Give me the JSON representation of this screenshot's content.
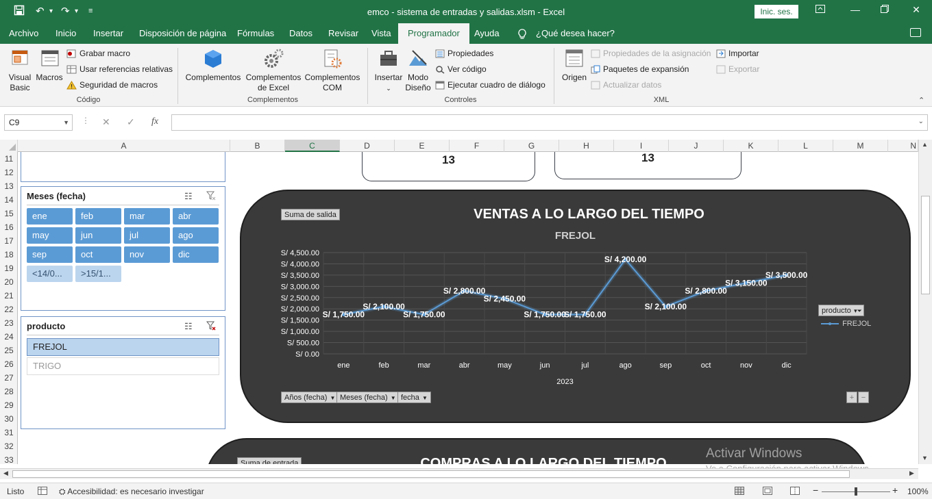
{
  "window": {
    "title": "emco - sistema de entradas y salidas.xlsm  -  Excel",
    "sign_in": "Inic. ses."
  },
  "menu": {
    "tabs": [
      "Archivo",
      "Inicio",
      "Insertar",
      "Disposición de página",
      "Fórmulas",
      "Datos",
      "Revisar",
      "Vista",
      "Programador",
      "Ayuda"
    ],
    "active_tab": "Programador",
    "tell_me": "¿Qué desea hacer?"
  },
  "ribbon": {
    "codigo": {
      "visual_basic": "Visual Basic",
      "visual_basic_l1": "Visual",
      "visual_basic_l2": "Basic",
      "macros": "Macros",
      "grabar_macro": "Grabar macro",
      "usar_referencias": "Usar referencias relativas",
      "seguridad": "Seguridad de macros",
      "group": "Código"
    },
    "complementos": {
      "complementos": "Complementos",
      "excel_l1": "Complementos",
      "excel_l2": "de Excel",
      "com_l1": "Complementos",
      "com_l2": "COM",
      "group": "Complementos"
    },
    "controles": {
      "insertar": "Insertar",
      "modo_l1": "Modo",
      "modo_l2": "Diseño",
      "propiedades": "Propiedades",
      "ver_codigo": "Ver código",
      "ejecutar": "Ejecutar cuadro de diálogo",
      "group": "Controles"
    },
    "xml": {
      "origen": "Origen",
      "propiedades_asignacion": "Propiedades de la asignación",
      "paquetes": "Paquetes de expansión",
      "actualizar": "Actualizar datos",
      "importar": "Importar",
      "exportar": "Exportar",
      "group": "XML"
    }
  },
  "formula_bar": {
    "name_box": "C9",
    "fx": "fx",
    "value": ""
  },
  "grid": {
    "columns": [
      "A",
      "B",
      "C",
      "D",
      "E",
      "F",
      "G",
      "H",
      "I",
      "J",
      "K",
      "L",
      "M",
      "N"
    ],
    "selected_column": "C",
    "rows": [
      "11",
      "12",
      "13",
      "14",
      "15",
      "16",
      "17",
      "18",
      "19",
      "20",
      "21",
      "22",
      "23",
      "24",
      "25",
      "26",
      "27",
      "28",
      "29",
      "30",
      "31",
      "32",
      "33"
    ]
  },
  "slicer_meses": {
    "title": "Meses (fecha)",
    "items": [
      "ene",
      "feb",
      "mar",
      "abr",
      "may",
      "jun",
      "jul",
      "ago",
      "sep",
      "oct",
      "nov",
      "dic"
    ],
    "extra": [
      "<14/0...",
      ">15/1..."
    ]
  },
  "slicer_producto": {
    "title": "producto",
    "items": [
      "FREJOL",
      "TRIGO"
    ],
    "selected": "FREJOL"
  },
  "kpis": {
    "left": "13",
    "right": "13"
  },
  "chart_panel": {
    "field_button": "Suma de salida",
    "title": "VENTAS A LO LARGO DEL TIEMPO",
    "subtitle": "FREJOL",
    "legend_filter": "producto",
    "legend_series": "FREJOL",
    "axis_buttons": [
      "Años (fecha)",
      "Meses (fecha)",
      "fecha"
    ],
    "plus": "+",
    "minus": "−"
  },
  "chart_data": {
    "type": "line",
    "title": "VENTAS A LO LARGO DEL TIEMPO",
    "subtitle": "FREJOL",
    "categories": [
      "ene",
      "feb",
      "mar",
      "abr",
      "may",
      "jun",
      "jul",
      "ago",
      "sep",
      "oct",
      "nov",
      "dic"
    ],
    "x_group_label": "2023",
    "series": [
      {
        "name": "FREJOL",
        "values": [
          1750,
          2100,
          1750,
          2800,
          2450,
          1750,
          1750,
          4200,
          2100,
          2800,
          3150,
          3500
        ],
        "labels": [
          "S/ 1,750.00",
          "S/ 2,100.00",
          "S/ 1,750.00",
          "S/ 2,800.00",
          "S/ 2,450.00",
          "S/ 1,750.00",
          "S/ 1,750.00",
          "S/ 4,200.00",
          "S/ 2,100.00",
          "S/ 2,800.00",
          "S/ 3,150.00",
          "S/ 3,500.00"
        ]
      }
    ],
    "y_ticks": [
      "S/ 0.00",
      "S/ 500.00",
      "S/ 1,000.00",
      "S/ 1,500.00",
      "S/ 2,000.00",
      "S/ 2,500.00",
      "S/ 3,000.00",
      "S/ 3,500.00",
      "S/ 4,000.00",
      "S/ 4,500.00"
    ],
    "ylim": [
      0,
      4500
    ],
    "grid": true,
    "legend": "right",
    "color": "#5b9bd5"
  },
  "second_panel": {
    "field_button": "Suma de entrada",
    "title": "COMPRAS A LO LARGO DEL TIEMPO"
  },
  "watermark": {
    "line1": "Activar Windows",
    "line2": "Ve a Configuración para activar Windows."
  },
  "status_bar": {
    "ready": "Listo",
    "accessibility": "Accesibilidad: es necesario investigar",
    "zoom": "100%"
  },
  "colors": {
    "brand": "#217346",
    "slicer_selected": "#5b9bd5",
    "panel_bg": "#3a3a3a"
  }
}
